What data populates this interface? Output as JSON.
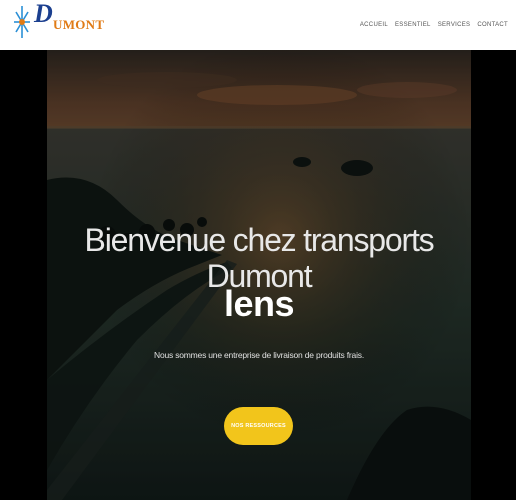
{
  "brand": {
    "logo_initial": "D",
    "logo_rest": "UMONT"
  },
  "nav": {
    "items": [
      {
        "label": "ACCUEIL"
      },
      {
        "label": "ESSENTIEL"
      },
      {
        "label": "SERVICES"
      },
      {
        "label": "CONTACT"
      }
    ]
  },
  "hero": {
    "headline": "Bienvenue chez transports Dumont",
    "city": "lens",
    "tagline": "Nous sommes une entreprise de livraison de produits frais.",
    "cta_label": "NOS RESSOURCES"
  },
  "colors": {
    "header_bg": "#ffffff",
    "cta_bg": "#f2c51b",
    "logo_blue": "#1b3f8f",
    "logo_orange": "#e07b16"
  }
}
